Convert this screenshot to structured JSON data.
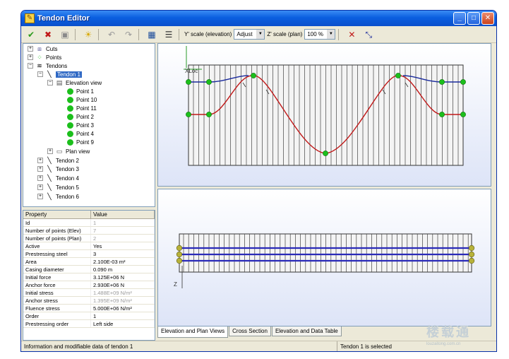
{
  "window": {
    "title": "Tendon Editor"
  },
  "toolbar": {
    "y_scale_label": "Y' scale (elevation)",
    "y_scale_value": "Adjust",
    "z_scale_label": "Z' scale (plan)",
    "z_scale_value": "100 %"
  },
  "tree": {
    "cuts": "Cuts",
    "points": "Points",
    "tendons": "Tendons",
    "tendon1": "Tendon 1",
    "elevation_view": "Elevation view",
    "elevation_points": [
      "Point 1",
      "Point 10",
      "Point 11",
      "Point 2",
      "Point 3",
      "Point 4",
      "Point 9"
    ],
    "plan_view": "Plan view",
    "other_tendons": [
      "Tendon 2",
      "Tendon 3",
      "Tendon 4",
      "Tendon 5",
      "Tendon 6"
    ]
  },
  "properties": {
    "header": {
      "property": "Property",
      "value": "Value"
    },
    "rows": [
      {
        "name": "Id",
        "value": "1",
        "dim": true
      },
      {
        "name": "Number of points (Elev)",
        "value": "7",
        "dim": true
      },
      {
        "name": "Number of points (Plan)",
        "value": "2",
        "dim": true
      },
      {
        "name": "Active",
        "value": "Yes",
        "dim": false
      },
      {
        "name": "Prestressing steel",
        "value": "3",
        "dim": false
      },
      {
        "name": "Area",
        "value": "2.100E-03 m²",
        "dim": false
      },
      {
        "name": "Casing diameter",
        "value": "0.090 m",
        "dim": false
      },
      {
        "name": "Initial force",
        "value": "3.125E+06 N",
        "dim": false
      },
      {
        "name": "Anchor force",
        "value": "2.930E+06 N",
        "dim": false
      },
      {
        "name": "Initial stress",
        "value": "1.488E+09 N/m²",
        "dim": true
      },
      {
        "name": "Anchor stress",
        "value": "1.395E+09 N/m²",
        "dim": true
      },
      {
        "name": "Fluence stress",
        "value": "5.000E+06 N/m²",
        "dim": false
      },
      {
        "name": "Order",
        "value": "1",
        "dim": false
      },
      {
        "name": "Prestressing order",
        "value": "Left side",
        "dim": false
      }
    ]
  },
  "elevation": {
    "axis_label": "XLoc"
  },
  "plan": {
    "axis_label": "Z"
  },
  "tabs": [
    "Elevation and Plan Views",
    "Cross Section",
    "Elevation and Data Table"
  ],
  "status": {
    "left": "Information and modifiable data of tendon 1",
    "right": "Tendon 1 is selected"
  },
  "watermark": {
    "main": "楼载通",
    "sub": "louzaitong.com.cn"
  },
  "colors": {
    "title_blue": "#0a5fe0",
    "curve_red": "#c01818",
    "curve_blue": "#1a2a9c",
    "point_green": "#1cbf1c",
    "plan_blue": "#2a2ab8"
  },
  "icons": {
    "ok": "check-icon",
    "cancel": "x-icon",
    "save": "save-icon",
    "help": "bulb-icon",
    "undo": "undo-icon",
    "redo": "redo-icon",
    "calc": "calculator-icon",
    "list": "list-icon",
    "delete": "delete-point-icon",
    "move": "move-point-icon"
  }
}
